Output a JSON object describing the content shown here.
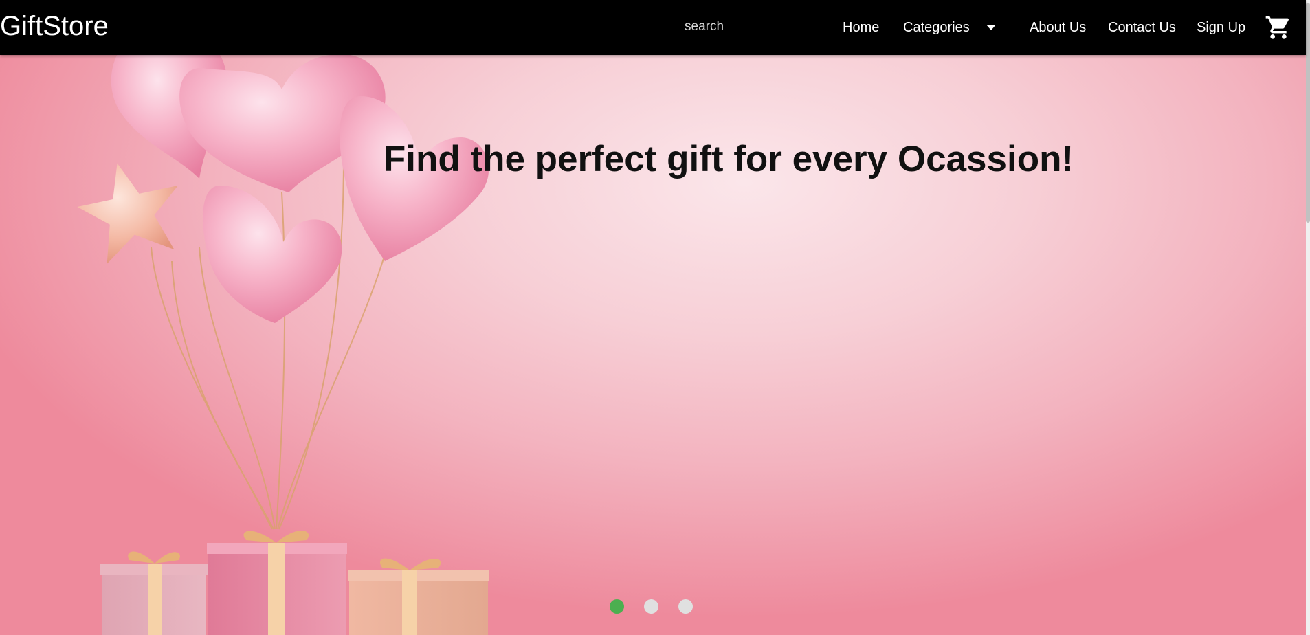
{
  "navbar": {
    "brand": "GiftStore",
    "search_placeholder": "search",
    "search_value": "",
    "links": {
      "home": "Home",
      "categories": "Categories",
      "about": "About Us",
      "contact": "Contact Us",
      "signup": "Sign Up"
    },
    "categories_icon": "caret-down-icon",
    "cart_icon": "shopping-cart-icon",
    "background_color": "#000000",
    "text_color": "#ffffff"
  },
  "hero": {
    "title": "Find the perfect gift for every Ocassion!",
    "slide_count": 3,
    "active_slide": 1,
    "active_dot_color": "#4caf50",
    "inactive_dot_color": "#e0e0e0",
    "background_color": "#f3b3bf"
  }
}
